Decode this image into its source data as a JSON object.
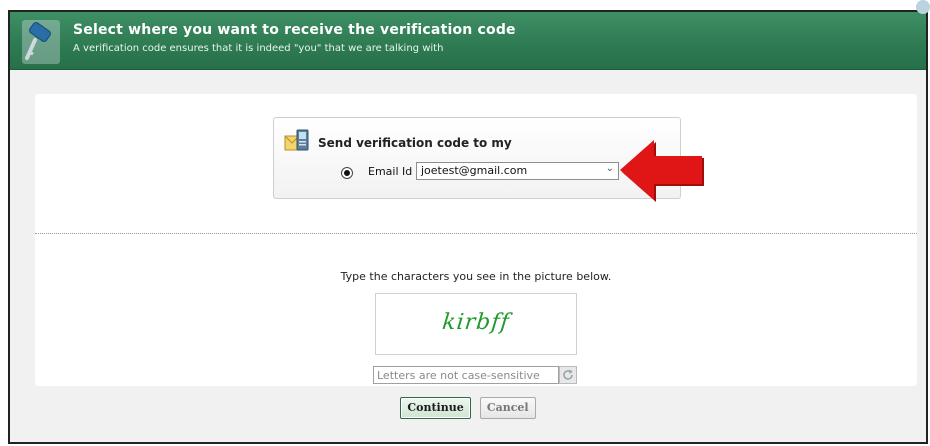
{
  "header": {
    "title": "Select where you want to receive the verification code",
    "subtitle": "A verification code ensures that it is indeed \"you\" that we are talking with"
  },
  "send_box": {
    "heading": "Send verification code to my",
    "option_label": "Email Id",
    "selected_email": "joetest@gmail.com"
  },
  "captcha": {
    "prompt": "Type the characters you see in the picture below.",
    "image_text": "kirbff",
    "input_placeholder": "Letters are not case-sensitive"
  },
  "buttons": {
    "continue_label": "Continue",
    "cancel_label": "Cancel"
  },
  "colors": {
    "header_green": "#2e7a52",
    "captcha_text": "#1e9a2a",
    "arrow_red": "#e01616"
  },
  "icons": {
    "header": "key-icon",
    "send_box": "phone-email-icon",
    "refresh": "refresh-icon",
    "pointer": "red-arrow"
  }
}
